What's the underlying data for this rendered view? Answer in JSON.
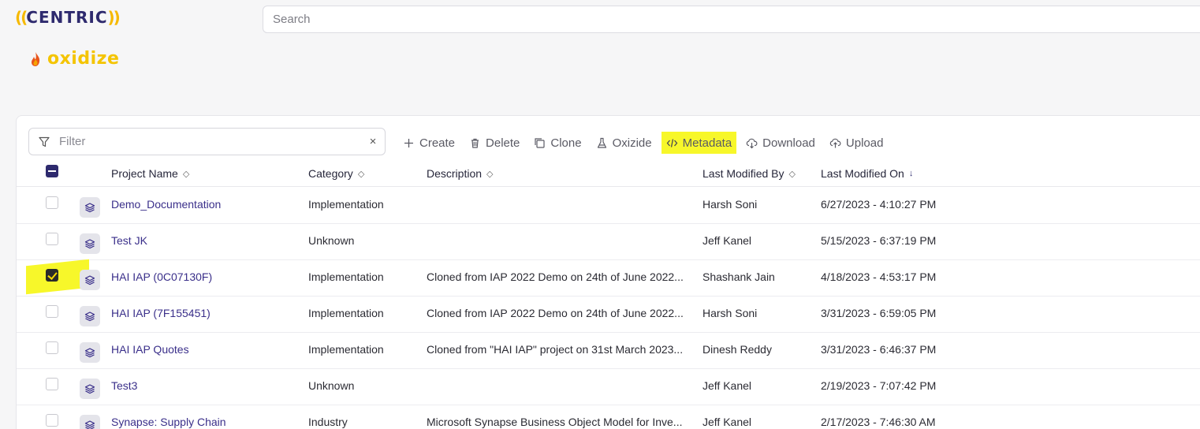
{
  "app": {
    "logo_text": "CENTRIC",
    "logo_paren_left": "((",
    "logo_paren_right": "))",
    "brand": "oxidize"
  },
  "search": {
    "placeholder": "Search"
  },
  "filter": {
    "placeholder": "Filter",
    "clear": "×"
  },
  "toolbar": {
    "create": "Create",
    "delete": "Delete",
    "clone": "Clone",
    "oxizide": "Oxizide",
    "metadata": "Metadata",
    "download": "Download",
    "upload": "Upload"
  },
  "table": {
    "headers": {
      "project_name": "Project Name",
      "category": "Category",
      "description": "Description",
      "last_modified_by": "Last Modified By",
      "last_modified_on": "Last Modified On"
    },
    "rows": [
      {
        "name": "Demo_Documentation",
        "category": "Implementation",
        "description": "",
        "modified_by": "Harsh Soni",
        "modified_on": "6/27/2023 - 4:10:27 PM",
        "checked": false
      },
      {
        "name": "Test JK",
        "category": "Unknown",
        "description": "",
        "modified_by": "Jeff Kanel",
        "modified_on": "5/15/2023 - 6:37:19 PM",
        "checked": false
      },
      {
        "name": "HAI IAP (0C07130F)",
        "category": "Implementation",
        "description": "Cloned from IAP 2022 Demo on 24th of June 2022...",
        "modified_by": "Shashank Jain",
        "modified_on": "4/18/2023 - 4:53:17 PM",
        "checked": true
      },
      {
        "name": "HAI IAP (7F155451)",
        "category": "Implementation",
        "description": "Cloned from IAP 2022 Demo on 24th of June 2022...",
        "modified_by": "Harsh Soni",
        "modified_on": "3/31/2023 - 6:59:05 PM",
        "checked": false
      },
      {
        "name": "HAI IAP Quotes",
        "category": "Implementation",
        "description": "Cloned from \"HAI IAP\" project on 31st March 2023...",
        "modified_by": "Dinesh Reddy",
        "modified_on": "3/31/2023 - 6:46:37 PM",
        "checked": false
      },
      {
        "name": "Test3",
        "category": "Unknown",
        "description": "",
        "modified_by": "Jeff Kanel",
        "modified_on": "2/19/2023 - 7:07:42 PM",
        "checked": false
      },
      {
        "name": "Synapse: Supply Chain",
        "category": "Industry",
        "description": "Microsoft Synapse Business Object Model for Inve...",
        "modified_by": "Jeff Kanel",
        "modified_on": "2/17/2023 - 7:46:30 AM",
        "checked": false
      }
    ]
  },
  "colors": {
    "brand_yellow": "#f4c400",
    "brand_navy": "#2e2a6e",
    "highlight": "#f7f72a",
    "link": "#3a2f8a"
  }
}
